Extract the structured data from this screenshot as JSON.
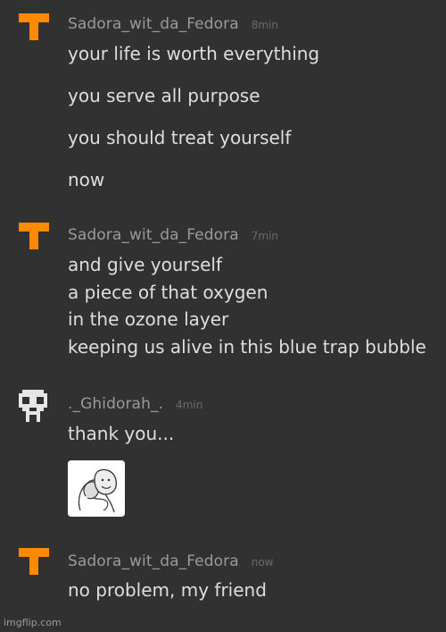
{
  "messages": [
    {
      "username": "Sadora_wit_da_Fedora",
      "time": "8min",
      "avatar_icon": "orange-t-avatar",
      "lines": [
        "your life is worth everything",
        "you serve all purpose",
        "you should treat yourself",
        "now"
      ]
    },
    {
      "username": "Sadora_wit_da_Fedora",
      "time": "7min",
      "avatar_icon": "orange-t-avatar",
      "lines": [
        "and give yourself",
        "a piece of that oxygen",
        "in the ozone layer",
        "keeping us alive in this blue trap bubble"
      ]
    },
    {
      "username": "._Ghidorah_.",
      "time": "4min",
      "avatar_icon": "pixel-skull-avatar",
      "lines": [
        "thank you..."
      ],
      "attachment": "meme-image-thumbnail"
    },
    {
      "username": "Sadora_wit_da_Fedora",
      "time": "now",
      "avatar_icon": "orange-t-avatar",
      "lines": [
        "no problem, my friend"
      ]
    }
  ],
  "watermark": "imgflip.com",
  "colors": {
    "background": "#313131",
    "accent_orange": "#ff8a00",
    "username": "#9a9a9a",
    "text": "#dedede"
  }
}
